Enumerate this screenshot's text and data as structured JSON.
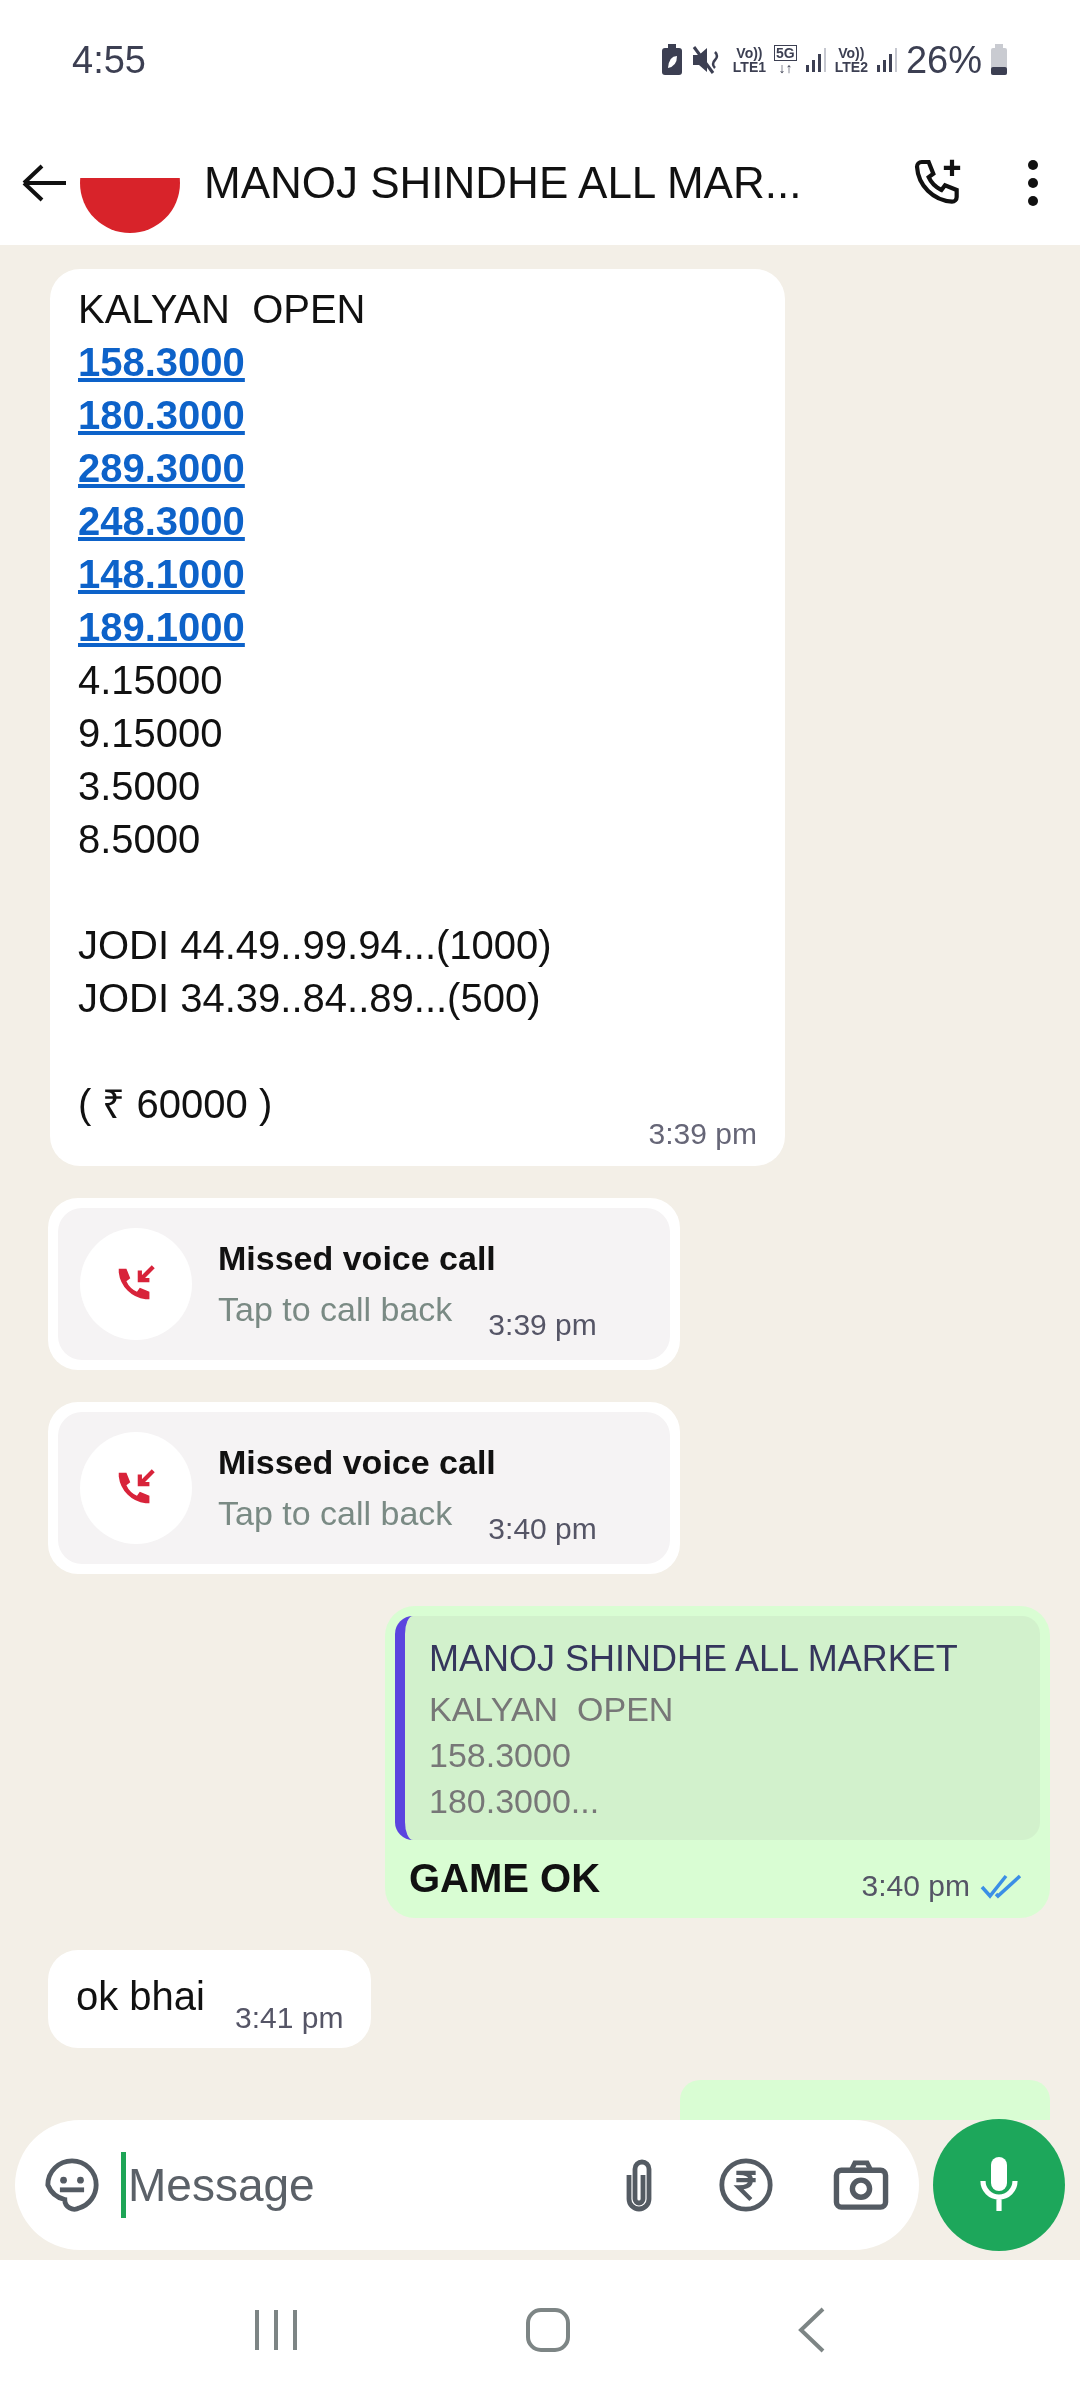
{
  "status_bar": {
    "time": "4:55",
    "volte1": "Vo))",
    "sim1": "LTE1",
    "network": "5G",
    "arrows": "↓↑",
    "volte2": "Vo))",
    "sim2": "LTE2",
    "battery": "26%"
  },
  "header": {
    "title": "MANOJ SHINDHE ALL MAR..."
  },
  "messages": [
    {
      "kind": "text",
      "lines": [
        {
          "kind": "plain",
          "text": "KALYAN  OPEN"
        },
        {
          "kind": "link",
          "text": "158.3000"
        },
        {
          "kind": "link",
          "text": "180.3000"
        },
        {
          "kind": "link",
          "text": "289.3000"
        },
        {
          "kind": "link",
          "text": "248.3000"
        },
        {
          "kind": "link",
          "text": "148.1000"
        },
        {
          "kind": "link",
          "text": "189.1000"
        },
        {
          "kind": "plain",
          "text": "4.15000"
        },
        {
          "kind": "plain",
          "text": "9.15000"
        },
        {
          "kind": "plain",
          "text": "3.5000"
        },
        {
          "kind": "plain",
          "text": "8.5000"
        },
        {
          "kind": "gap"
        },
        {
          "kind": "plain",
          "text": "JODI 44.49..99.94...(1000)"
        },
        {
          "kind": "plain",
          "text": "JODI 34.39..84..89...(500)"
        },
        {
          "kind": "gap"
        },
        {
          "kind": "plain",
          "text": "( ₹ 60000 )"
        }
      ],
      "time": "3:39 pm"
    },
    {
      "kind": "call",
      "title": "Missed voice call",
      "subtitle": "Tap to call back",
      "time": "3:39 pm"
    },
    {
      "kind": "call",
      "title": "Missed voice call",
      "subtitle": "Tap to call back",
      "time": "3:40 pm"
    },
    {
      "kind": "reply",
      "quote": {
        "author": "MANOJ SHINDHE ALL MARKET",
        "lines": [
          "KALYAN  OPEN",
          "158.3000",
          "180.3000..."
        ]
      },
      "text": "GAME OK",
      "time": "3:40 pm",
      "read": true
    },
    {
      "kind": "short",
      "text": "ok bhai",
      "time": "3:41 pm"
    },
    {
      "kind": "partial"
    }
  ],
  "composer": {
    "placeholder": "Message"
  }
}
